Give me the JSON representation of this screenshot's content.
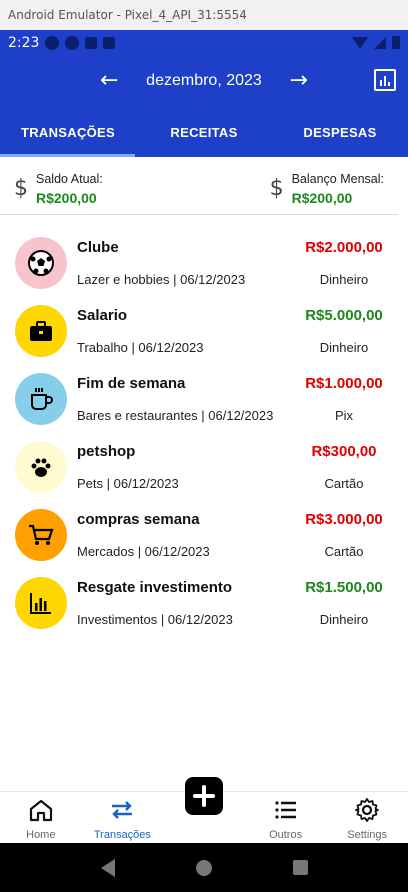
{
  "window": {
    "title": "Android Emulator - Pixel_4_API_31:5554"
  },
  "status_bar": {
    "time": "2:23"
  },
  "header": {
    "prev_icon": "arrow-left-icon",
    "month": "dezembro, 2023",
    "next_icon": "arrow-right-icon",
    "report_icon": "bar-chart-icon"
  },
  "tabs": [
    {
      "label": "TRANSAÇÕES",
      "active": true
    },
    {
      "label": "RECEITAS",
      "active": false
    },
    {
      "label": "DESPESAS",
      "active": false
    }
  ],
  "summary": {
    "current_balance_label": "Saldo Atual:",
    "current_balance_value": "R$200,00",
    "monthly_balance_label": "Balanço Mensal:",
    "monthly_balance_value": "R$200,00",
    "icon": "dollar-icon"
  },
  "transactions": [
    {
      "name": "Clube",
      "meta": "Lazer e hobbies | 06/12/2023",
      "amount": "R$2.000,00",
      "type": "expense",
      "method": "Dinheiro",
      "icon": "soccer-ball-icon",
      "icon_bg": "#f7c4cc"
    },
    {
      "name": "Salario",
      "meta": "Trabalho | 06/12/2023",
      "amount": "R$5.000,00",
      "type": "income",
      "method": "Dinheiro",
      "icon": "briefcase-icon",
      "icon_bg": "#ffd600"
    },
    {
      "name": "Fim de semana",
      "meta": "Bares e restaurantes | 06/12/2023",
      "amount": "R$1.000,00",
      "type": "expense",
      "method": "Pix",
      "icon": "coffee-cup-icon",
      "icon_bg": "#87ceeb"
    },
    {
      "name": "petshop",
      "meta": "Pets | 06/12/2023",
      "amount": "R$300,00",
      "type": "expense",
      "method": "Cartão",
      "icon": "paw-icon",
      "icon_bg": "#fffbd0"
    },
    {
      "name": "compras semana",
      "meta": "Mercados | 06/12/2023",
      "amount": "R$3.000,00",
      "type": "expense",
      "method": "Cartão",
      "icon": "shopping-cart-icon",
      "icon_bg": "#ffa000"
    },
    {
      "name": "Resgate investimento",
      "meta": "Investimentos | 06/12/2023",
      "amount": "R$1.500,00",
      "type": "income",
      "method": "Dinheiro",
      "icon": "bar-chart-icon",
      "icon_bg": "#ffd600"
    }
  ],
  "colors": {
    "primary": "#1e40c8",
    "expense": "#e00000",
    "income": "#1a8a1a",
    "nav_active": "#1565c0"
  },
  "bottom_nav": {
    "home": "Home",
    "transactions": "Transações",
    "add_icon": "plus-icon",
    "others": "Outros",
    "settings": "Settings"
  }
}
